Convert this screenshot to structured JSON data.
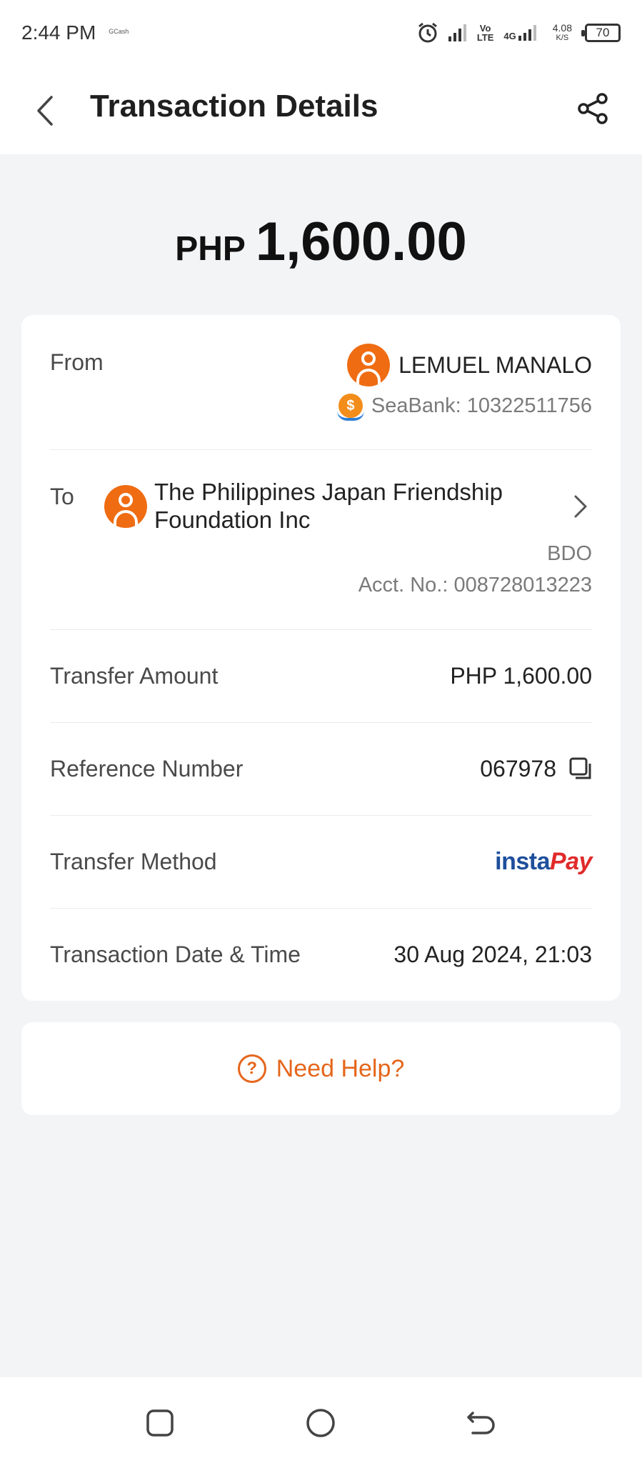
{
  "status_bar": {
    "time": "2:44 PM",
    "app_label": "GCash",
    "vo_lte_top": "Vo",
    "vo_lte_bottom": "LTE",
    "net_type": "4G",
    "speed_value": "4.08",
    "speed_unit": "K/S",
    "battery": "70",
    "icons": [
      "alarm-icon",
      "signal-icon",
      "signal-4g-icon",
      "battery-icon"
    ]
  },
  "header": {
    "title": "Transaction Details",
    "back_icon": "chevron-left-icon",
    "share_icon": "share-icon"
  },
  "amount": {
    "currency": "PHP",
    "value": "1,600.00"
  },
  "details": {
    "from": {
      "label": "From",
      "name": "LEMUEL MANALO",
      "bank": "SeaBank: 10322511756"
    },
    "to": {
      "label": "To",
      "name": "The Philippines Japan Friendship Foundation Inc",
      "bank": "BDO",
      "account": "Acct. No.: 008728013223"
    },
    "transfer_amount": {
      "label": "Transfer Amount",
      "value": "PHP 1,600.00"
    },
    "reference_number": {
      "label": "Reference Number",
      "value": "067978"
    },
    "transfer_method": {
      "label": "Transfer Method",
      "logo_insta": "insta",
      "logo_pay": "Pay"
    },
    "transaction_date": {
      "label": "Transaction Date & Time",
      "value": "30 Aug 2024, 21:03"
    }
  },
  "help": {
    "icon_text": "?",
    "label": "Need Help?"
  },
  "colors": {
    "accent": "#e5661b",
    "avatar": "#ef6c12",
    "background": "#f3f4f6",
    "instapay_blue": "#1e4f9c",
    "instapay_red": "#e12a2a"
  }
}
